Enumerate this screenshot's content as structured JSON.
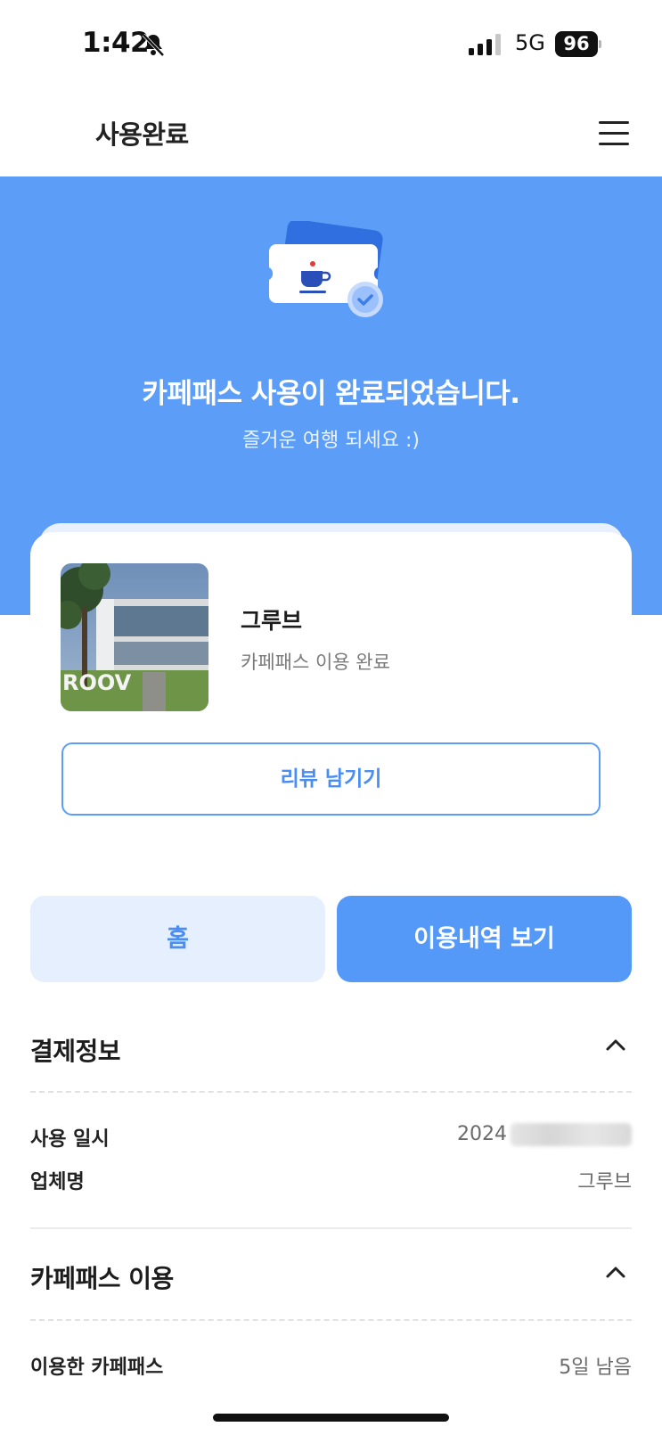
{
  "status_bar": {
    "time": "1:42",
    "network": "5G",
    "battery": "96",
    "icons": [
      "bell-slash-icon",
      "signal-icon",
      "battery-icon"
    ]
  },
  "nav": {
    "title": "사용완료",
    "menu_icon": "hamburger-menu-icon"
  },
  "hero": {
    "title": "카페패스 사용이 완료되었습니다.",
    "subtitle": "즐거운 여행 되세요 :)",
    "illustration_icon": "coffee-ticket-check-icon",
    "background_color": "#5c9ef7"
  },
  "venue": {
    "name": "그루브",
    "status": "카페패스 이용 완료",
    "thumbnail_sign": "ROOV",
    "review_button": "리뷰 남기기"
  },
  "actions": {
    "home": "홈",
    "history": "이용내역 보기"
  },
  "payment_section": {
    "title": "결제정보",
    "rows": [
      {
        "label": "사용 일시",
        "value": "2024"
      },
      {
        "label": "업체명",
        "value": "그루브"
      }
    ]
  },
  "cafepass_section": {
    "title": "카페패스 이용",
    "rows": [
      {
        "label": "이용한 카페패스",
        "value": "5일 남음"
      }
    ]
  },
  "colors": {
    "accent": "#5599f8",
    "accent_light": "#e5effd",
    "text_primary": "#1c1c1c",
    "text_secondary": "#6b6b6b"
  }
}
